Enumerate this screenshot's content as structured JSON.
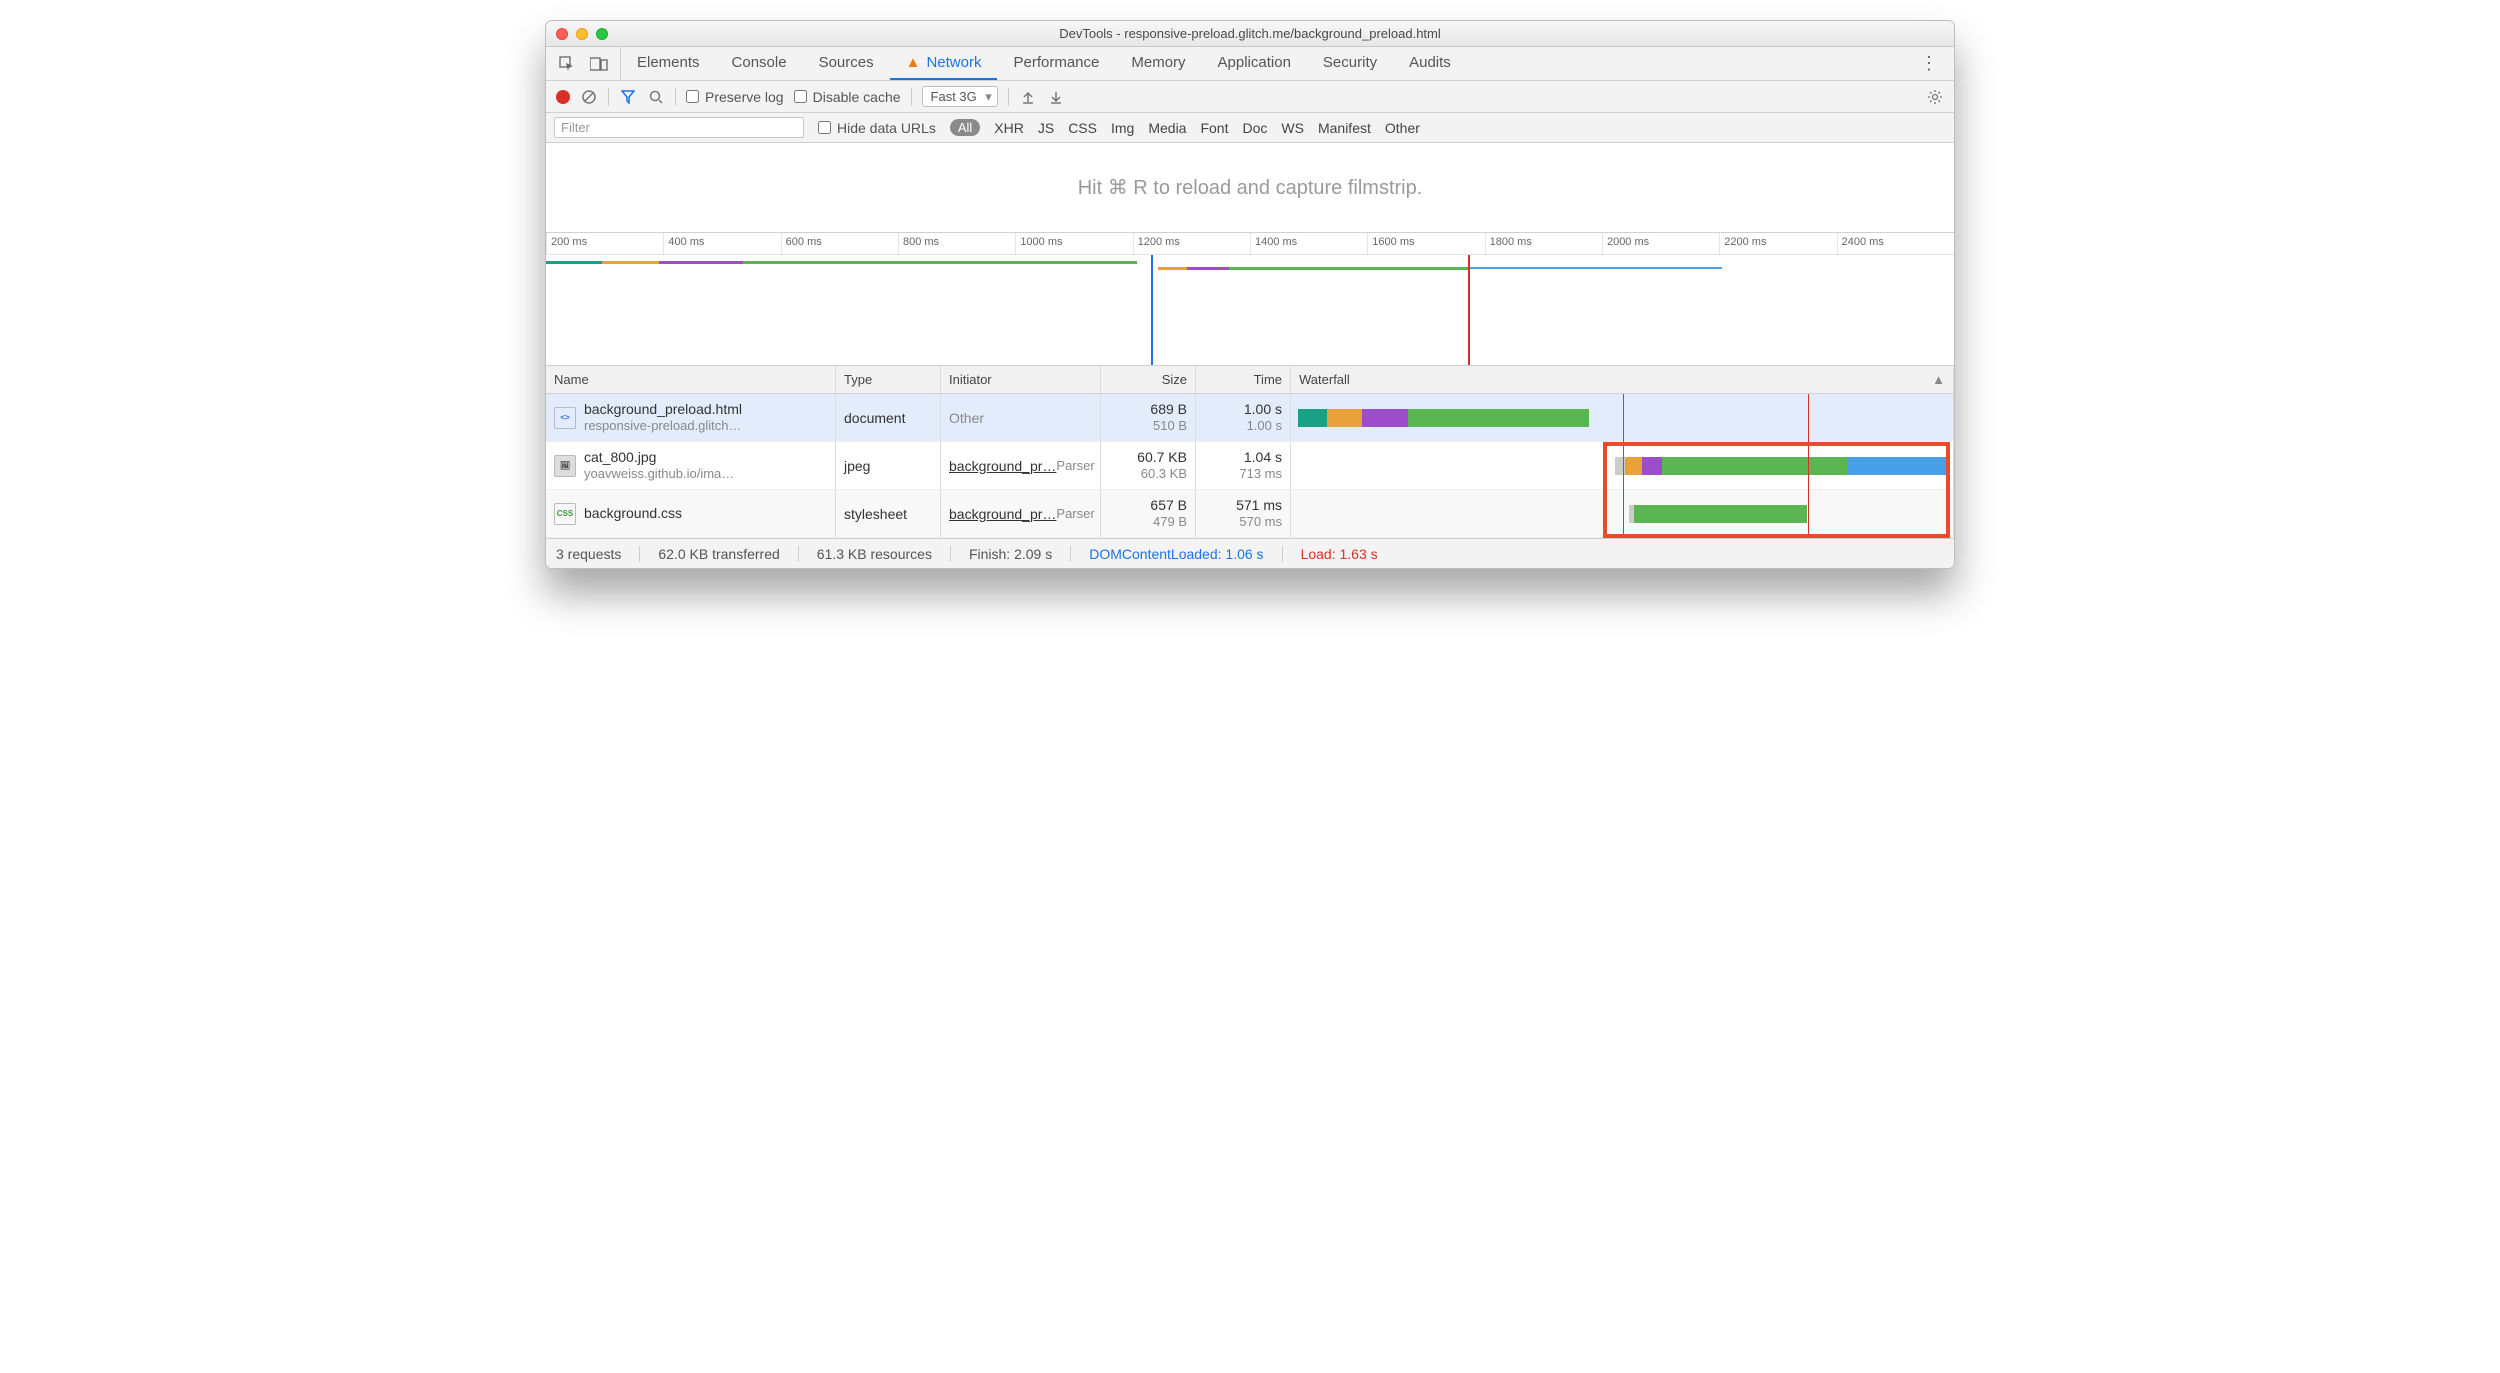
{
  "window": {
    "title": "DevTools - responsive-preload.glitch.me/background_preload.html"
  },
  "tabs": [
    "Elements",
    "Console",
    "Sources",
    "Network",
    "Performance",
    "Memory",
    "Application",
    "Security",
    "Audits"
  ],
  "active_tab": "Network",
  "toolbar": {
    "preserve_log": "Preserve log",
    "disable_cache": "Disable cache",
    "throttle": "Fast 3G"
  },
  "filter": {
    "placeholder": "Filter",
    "hide_data_urls": "Hide data URLs",
    "all": "All",
    "types": [
      "XHR",
      "JS",
      "CSS",
      "Img",
      "Media",
      "Font",
      "Doc",
      "WS",
      "Manifest",
      "Other"
    ]
  },
  "filmstrip": {
    "hint": "Hit ⌘ R to reload and capture filmstrip."
  },
  "ruler": [
    "200 ms",
    "400 ms",
    "600 ms",
    "800 ms",
    "1000 ms",
    "1200 ms",
    "1400 ms",
    "1600 ms",
    "1800 ms",
    "2000 ms",
    "2200 ms",
    "2400 ms"
  ],
  "columns": {
    "name": "Name",
    "type": "Type",
    "initiator": "Initiator",
    "size": "Size",
    "time": "Time",
    "waterfall": "Waterfall"
  },
  "rows": [
    {
      "name": "background_preload.html",
      "sub": "responsive-preload.glitch…",
      "type": "document",
      "initiator": "Other",
      "initiator_sub": "",
      "size": "689 B",
      "size_sub": "510 B",
      "time": "1.00 s",
      "time_sub": "1.00 s"
    },
    {
      "name": "cat_800.jpg",
      "sub": "yoavweiss.github.io/ima…",
      "type": "jpeg",
      "initiator": "background_pr…",
      "initiator_sub": "Parser",
      "size": "60.7 KB",
      "size_sub": "60.3 KB",
      "time": "1.04 s",
      "time_sub": "713 ms"
    },
    {
      "name": "background.css",
      "sub": "",
      "type": "stylesheet",
      "initiator": "background_pr…",
      "initiator_sub": "Parser",
      "size": "657 B",
      "size_sub": "479 B",
      "time": "571 ms",
      "time_sub": "570 ms"
    }
  ],
  "status": {
    "requests": "3 requests",
    "transferred": "62.0 KB transferred",
    "resources": "61.3 KB resources",
    "finish": "Finish: 2.09 s",
    "dom": "DOMContentLoaded: 1.06 s",
    "load": "Load: 1.63 s"
  },
  "colors": {
    "green": "#5ab552",
    "orange": "#e8a23c",
    "purple": "#9b4dca",
    "teal": "#1aa085",
    "blue": "#4aa0e8",
    "red": "#e8492f"
  }
}
